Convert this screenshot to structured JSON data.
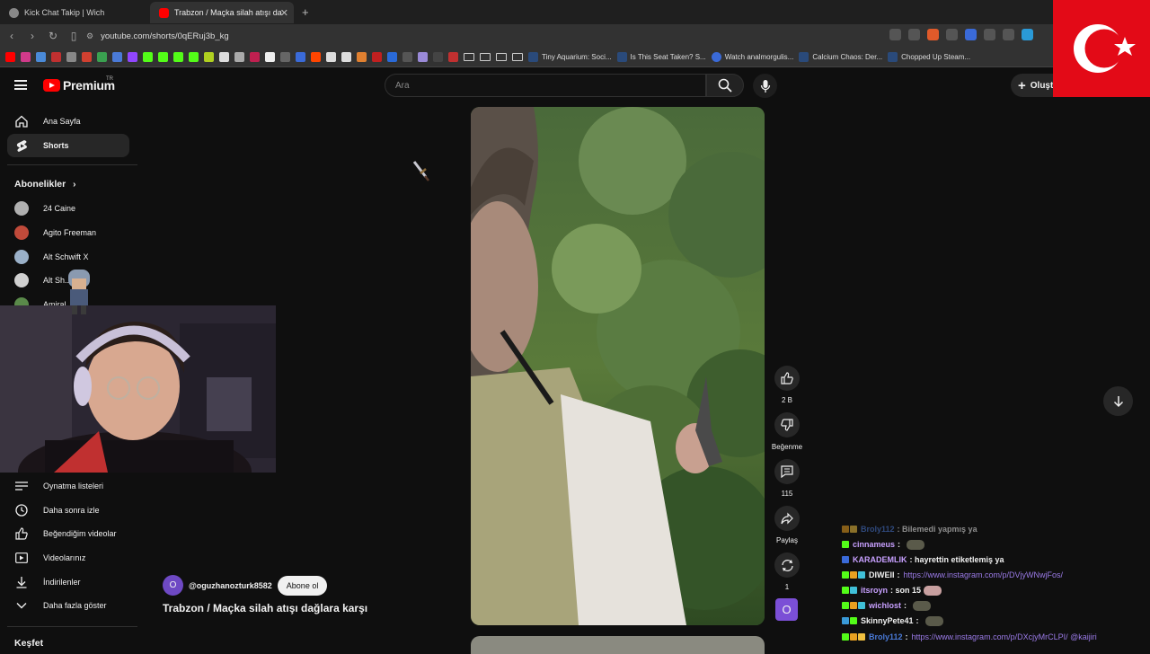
{
  "browser": {
    "tabs": [
      {
        "title": "Kick Chat Takip | Wich",
        "active": false
      },
      {
        "title": "Trabzon / Maçka silah atışı da",
        "active": true
      }
    ],
    "url": "youtube.com/shorts/0qERuj3b_kg",
    "bookmarks": [
      "Tiny Aquarium: Soci...",
      "Is This Seat Taken? S...",
      "Watch analmorgulis...",
      "Calcium Chaos: Der...",
      "Chopped Up Steam..."
    ]
  },
  "youtube": {
    "logo": "Premium",
    "logo_region": "TR",
    "search_placeholder": "Ara",
    "create_label": "Oluşt",
    "nav": [
      {
        "label": "Ana Sayfa",
        "icon": "home-icon"
      },
      {
        "label": "Shorts",
        "icon": "shorts-icon",
        "active": true
      }
    ],
    "subs_header": "Abonelikler",
    "subscriptions": [
      {
        "name": "24 Caine",
        "color": "#b0b0b0"
      },
      {
        "name": "Agito Freeman",
        "color": "#c04a3a"
      },
      {
        "name": "Alt Schwift X",
        "color": "#9ab0c8"
      },
      {
        "name": "Alt Sh...",
        "color": "#d0d0d0"
      },
      {
        "name": "Amiral ...ılu",
        "color": "#5a8a4a"
      }
    ],
    "you_items": [
      {
        "label": "Oynatma listeleri",
        "icon": "playlist-icon"
      },
      {
        "label": "Daha sonra izle",
        "icon": "clock-icon"
      },
      {
        "label": "Beğendiğim videolar",
        "icon": "like-icon"
      },
      {
        "label": "Videolarınız",
        "icon": "video-icon"
      },
      {
        "label": "İndirilenler",
        "icon": "download-icon"
      },
      {
        "label": "Daha fazla göster",
        "icon": "chevron-down-icon"
      }
    ],
    "explore_header": "Keşfet",
    "short": {
      "channel_initial": "O",
      "channel_name": "@oguzhanozturk8582",
      "subscribe_label": "Abone ol",
      "title": "Trabzon / Maçka silah atışı dağlara karşı",
      "likes": "2 B",
      "dislike_label": "Beğenme",
      "comments": "115",
      "share_label": "Paylaş",
      "remix_count": "1"
    }
  },
  "chat": [
    {
      "user": "Broly112",
      "text": ": Bilemedi yapmış ya",
      "user_color": "#4a7ad8",
      "badges": [
        "#e8a020",
        "#f0c040"
      ]
    },
    {
      "user": "cinnameus",
      "text": ":",
      "emote": true,
      "user_color": "#c8a0ff",
      "badges": [
        "#53fc18"
      ]
    },
    {
      "user": "KARADEMLIK",
      "text": ": hayrettin etiketlemiş ya",
      "user_color": "#c8a0ff",
      "badges": [
        "#3a6ad8"
      ]
    },
    {
      "user": "DIWEII",
      "text": ":",
      "link": "https://www.instagram.com/p/DVjyWNwjFos/",
      "user_color": "#f1f1f1",
      "badges": [
        "#53fc18",
        "#e8a020",
        "#40c0d8"
      ]
    },
    {
      "user": "itsroyn",
      "text": ": son 15",
      "emote": true,
      "user_color": "#c8a0ff",
      "badges": [
        "#53fc18",
        "#40c0d8"
      ]
    },
    {
      "user": "wichlost",
      "text": ":",
      "emote": true,
      "user_color": "#c8a0ff",
      "badges": [
        "#53fc18",
        "#e8a020",
        "#40c0d8"
      ]
    },
    {
      "user": "SkinnyPete41",
      "text": ":",
      "emote": true,
      "user_color": "#f1f1f1",
      "badges": [
        "#3a9ad8",
        "#53fc18"
      ]
    },
    {
      "user": "Broly112",
      "text": ":",
      "link": "https://www.instagram.com/p/DXcjyMrCLPI/ @kaijiri",
      "user_color": "#4a7ad8",
      "badges": [
        "#53fc18",
        "#e8a020",
        "#f0c040"
      ]
    }
  ]
}
